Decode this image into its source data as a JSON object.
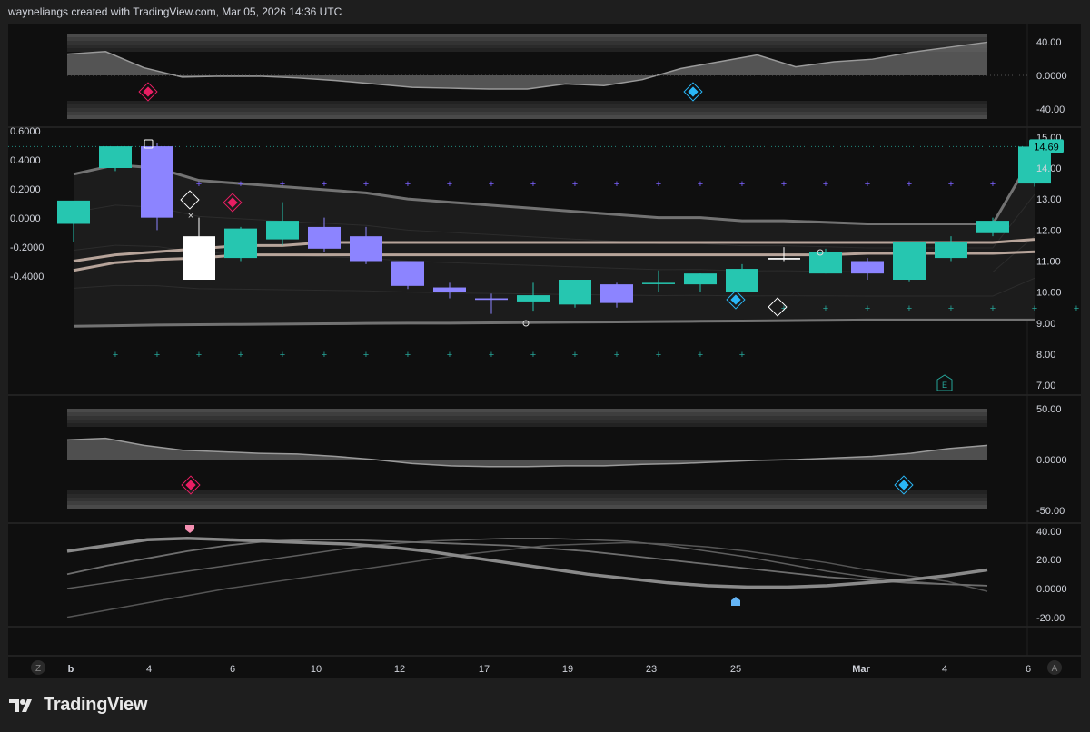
{
  "header": {
    "caption": "wayneliangs created with TradingView.com, Mar 05, 2026 14:36 UTC"
  },
  "footer": {
    "brand": "TradingView",
    "left_button": "Z",
    "right_button": "A"
  },
  "chart_data": [
    {
      "type": "area",
      "panel": "oscillator-1",
      "y_ticks": [
        "40.00",
        "0.0000",
        "-40.00"
      ],
      "ylim": [
        -48,
        48
      ],
      "x": [
        "3",
        "4",
        "5",
        "6",
        "8",
        "9",
        "10",
        "11",
        "12",
        "13",
        "16",
        "17",
        "18",
        "19",
        "20",
        "23",
        "24",
        "25",
        "26",
        "27",
        "Mar",
        "2",
        "3",
        "4",
        "5"
      ],
      "values": [
        25,
        28,
        9,
        -2,
        -1,
        -1,
        -3,
        -6,
        -10,
        -14,
        -15,
        -16,
        -16,
        -10,
        -12,
        -5,
        8,
        16,
        24,
        10,
        16,
        19,
        27,
        33,
        39
      ],
      "signals": [
        {
          "x": "4",
          "kind": "sell-diamond"
        },
        {
          "x": "24",
          "kind": "buy-diamond"
        }
      ]
    },
    {
      "type": "candlestick",
      "panel": "main",
      "left_axis_ticks": [
        "0.6000",
        "0.4000",
        "0.2000",
        "0.0000",
        "-0.2000",
        "-0.4000"
      ],
      "right_axis_ticks": [
        "15.00",
        "14.00",
        "13.00",
        "12.00",
        "11.00",
        "10.00",
        "9.00",
        "8.00",
        "7.00"
      ],
      "ylim": [
        6.8,
        15.2
      ],
      "last_price_label": "14.69",
      "candles": [
        {
          "x": "3",
          "o": 12.2,
          "h": 12.9,
          "l": 11.6,
          "c": 12.95
        },
        {
          "x": "4",
          "o": 14.0,
          "h": 14.6,
          "l": 13.9,
          "c": 14.7
        },
        {
          "x": "5",
          "o": 14.7,
          "h": 14.8,
          "l": 12.0,
          "c": 12.4
        },
        {
          "x": "6",
          "o": 11.8,
          "h": 12.4,
          "l": 10.4,
          "c": 10.4
        },
        {
          "x": "7",
          "o": 11.1,
          "h": 12.1,
          "l": 11.0,
          "c": 12.05
        },
        {
          "x": "8",
          "o": 11.7,
          "h": 12.9,
          "l": 11.5,
          "c": 12.3
        },
        {
          "x": "9",
          "o": 12.1,
          "h": 12.4,
          "l": 11.3,
          "c": 11.4
        },
        {
          "x": "10",
          "o": 11.8,
          "h": 12.1,
          "l": 10.9,
          "c": 11.0
        },
        {
          "x": "11",
          "o": 11.0,
          "h": 11.0,
          "l": 10.1,
          "c": 10.2
        },
        {
          "x": "12",
          "o": 10.15,
          "h": 10.3,
          "l": 9.8,
          "c": 10.0
        },
        {
          "x": "13",
          "o": 9.8,
          "h": 9.95,
          "l": 9.3,
          "c": 9.75
        },
        {
          "x": "16",
          "o": 9.7,
          "h": 10.3,
          "l": 9.4,
          "c": 9.9
        },
        {
          "x": "17",
          "o": 9.6,
          "h": 10.4,
          "l": 9.5,
          "c": 10.4
        },
        {
          "x": "18",
          "o": 10.25,
          "h": 10.3,
          "l": 9.5,
          "c": 9.65
        },
        {
          "x": "19",
          "o": 10.3,
          "h": 10.7,
          "l": 10.0,
          "c": 10.3
        },
        {
          "x": "20",
          "o": 10.25,
          "h": 10.6,
          "l": 10.0,
          "c": 10.6
        },
        {
          "x": "23",
          "o": 10.0,
          "h": 10.9,
          "l": 10.0,
          "c": 10.75
        },
        {
          "x": "24",
          "o": 11.1,
          "h": 11.45,
          "l": 11.0,
          "c": 11.05
        },
        {
          "x": "25",
          "o": 10.6,
          "h": 11.4,
          "l": 10.6,
          "c": 11.3
        },
        {
          "x": "26",
          "o": 11.0,
          "h": 11.1,
          "l": 10.4,
          "c": 10.6
        },
        {
          "x": "27",
          "o": 10.4,
          "h": 11.6,
          "l": 10.35,
          "c": 11.6
        },
        {
          "x": "Mar",
          "o": 11.1,
          "h": 11.8,
          "l": 11.0,
          "c": 11.6
        },
        {
          "x": "2",
          "o": 11.9,
          "h": 12.4,
          "l": 11.8,
          "c": 12.3
        },
        {
          "x": "3",
          "o": 13.5,
          "h": 14.7,
          "l": 13.4,
          "c": 14.69
        }
      ],
      "lines": [
        {
          "name": "upper",
          "values": [
            13.8,
            14.1,
            14.0,
            13.6,
            13.5,
            13.4,
            13.3,
            13.2,
            13.0,
            12.9,
            12.8,
            12.7,
            12.6,
            12.5,
            12.4,
            12.4,
            12.3,
            12.3,
            12.25,
            12.2,
            12.2,
            12.2,
            12.2,
            14.5
          ]
        },
        {
          "name": "basis-a",
          "values": [
            11.0,
            11.2,
            11.3,
            11.4,
            11.5,
            11.5,
            11.6,
            11.6,
            11.6,
            11.6,
            11.6,
            11.6,
            11.6,
            11.6,
            11.6,
            11.6,
            11.6,
            11.6,
            11.6,
            11.6,
            11.6,
            11.6,
            11.6,
            11.7
          ]
        },
        {
          "name": "basis-b",
          "values": [
            10.7,
            10.95,
            11.05,
            11.1,
            11.2,
            11.2,
            11.2,
            11.2,
            11.2,
            11.2,
            11.2,
            11.2,
            11.2,
            11.2,
            11.2,
            11.2,
            11.2,
            11.2,
            11.2,
            11.25,
            11.25,
            11.25,
            11.25,
            11.3
          ]
        },
        {
          "name": "lower",
          "values": [
            8.9,
            8.92,
            8.94,
            8.95,
            8.96,
            8.97,
            8.98,
            8.99,
            9.0,
            9.0,
            9.01,
            9.02,
            9.03,
            9.04,
            9.05,
            9.06,
            9.07,
            9.08,
            9.09,
            9.1,
            9.1,
            9.1,
            9.1,
            9.1
          ]
        }
      ],
      "upper_dots": [
        14.5,
        13.5,
        13.5,
        13.5,
        13.5,
        13.5,
        13.5,
        13.5,
        13.5,
        13.5,
        13.5,
        13.5,
        13.5,
        13.5,
        13.5,
        13.5,
        13.5,
        13.5,
        13.5,
        13.5,
        13.5,
        13.5
      ],
      "lower_dots": [
        8.0,
        8.0,
        8.0,
        8.0,
        8.0,
        8.0,
        8.0,
        8.0,
        8.0,
        8.0,
        8.0,
        8.0,
        8.0,
        8.0,
        8.0,
        8.0
      ],
      "late_lower_dots": [
        9.5,
        9.5,
        9.5,
        9.5,
        9.5,
        9.5,
        9.5,
        9.5
      ],
      "earnings_marker": "E"
    },
    {
      "type": "area",
      "panel": "oscillator-2",
      "y_ticks": [
        "50.00",
        "0.0000",
        "-50.00"
      ],
      "ylim": [
        -60,
        60
      ],
      "values": [
        25,
        27,
        18,
        12,
        10,
        8,
        7,
        4,
        0,
        -5,
        -8,
        -9,
        -9,
        -8,
        -8,
        -6,
        -5,
        -3,
        -1,
        0,
        2,
        4,
        8,
        14,
        18
      ]
    },
    {
      "type": "line",
      "panel": "oscillator-3",
      "y_ticks": [
        "40.00",
        "20.00",
        "0.0000",
        "-20.00"
      ],
      "ylim": [
        -25,
        45
      ],
      "series": [
        {
          "values": [
            26,
            30,
            34,
            35,
            34,
            33,
            32,
            31,
            29,
            26,
            22,
            18,
            14,
            10,
            7,
            4,
            2,
            1,
            1,
            2,
            4,
            6,
            9,
            13
          ]
        },
        {
          "values": [
            10,
            16,
            21,
            26,
            30,
            33,
            34,
            34,
            33,
            32,
            31,
            30,
            28,
            26,
            23,
            20,
            17,
            14,
            11,
            8,
            6,
            4,
            3,
            2
          ]
        },
        {
          "values": [
            0,
            4,
            8,
            12,
            16,
            20,
            24,
            28,
            31,
            33,
            34,
            35,
            35,
            34,
            33,
            30,
            26,
            22,
            17,
            12,
            8,
            5,
            3,
            2
          ]
        },
        {
          "values": [
            -20,
            -15,
            -10,
            -5,
            0,
            4,
            8,
            12,
            16,
            20,
            24,
            27,
            30,
            31,
            32,
            31,
            29,
            26,
            22,
            18,
            13,
            9,
            5,
            -2
          ]
        }
      ]
    }
  ],
  "x_axis": {
    "labels": [
      "b",
      "4",
      "6",
      "10",
      "12",
      "17",
      "19",
      "23",
      "25",
      "Mar",
      "4",
      "6"
    ]
  }
}
